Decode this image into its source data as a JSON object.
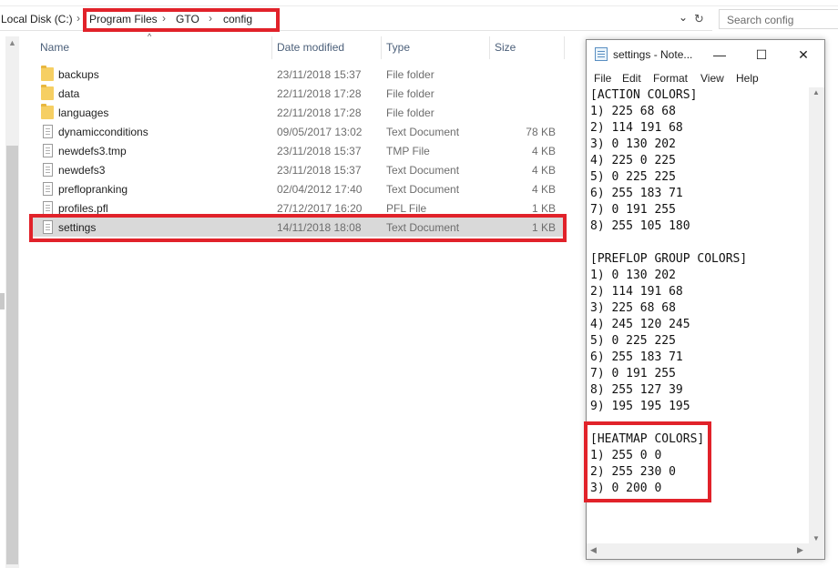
{
  "explorer": {
    "breadcrumb": [
      "Local Disk (C:)",
      "Program Files",
      "GTO",
      "config"
    ],
    "search_placeholder": "Search config",
    "columns": {
      "name": "Name",
      "date": "Date modified",
      "type": "Type",
      "size": "Size"
    },
    "files": [
      {
        "name": "backups",
        "date": "23/11/2018 15:37",
        "type": "File folder",
        "size": "",
        "icon": "folder-icon"
      },
      {
        "name": "data",
        "date": "22/11/2018 17:28",
        "type": "File folder",
        "size": "",
        "icon": "folder-icon"
      },
      {
        "name": "languages",
        "date": "22/11/2018 17:28",
        "type": "File folder",
        "size": "",
        "icon": "folder-icon"
      },
      {
        "name": "dynamicconditions",
        "date": "09/05/2017 13:02",
        "type": "Text Document",
        "size": "78 KB",
        "icon": "document-icon"
      },
      {
        "name": "newdefs3.tmp",
        "date": "23/11/2018 15:37",
        "type": "TMP File",
        "size": "4 KB",
        "icon": "document-icon"
      },
      {
        "name": "newdefs3",
        "date": "23/11/2018 15:37",
        "type": "Text Document",
        "size": "4 KB",
        "icon": "document-icon"
      },
      {
        "name": "preflopranking",
        "date": "02/04/2012 17:40",
        "type": "Text Document",
        "size": "4 KB",
        "icon": "document-icon"
      },
      {
        "name": "profiles.pfl",
        "date": "27/12/2017 16:20",
        "type": "PFL File",
        "size": "1 KB",
        "icon": "document-icon"
      },
      {
        "name": "settings",
        "date": "14/11/2018 18:08",
        "type": "Text Document",
        "size": "1 KB",
        "icon": "document-icon",
        "selected": true
      }
    ]
  },
  "notepad": {
    "title": "settings - Note...",
    "window_buttons": {
      "minimize": "—",
      "maximize": "☐",
      "close": "✕"
    },
    "menu": [
      "File",
      "Edit",
      "Format",
      "View",
      "Help"
    ],
    "lines": [
      "[ACTION COLORS]",
      "1) 225 68 68",
      "2) 114 191 68",
      "3) 0 130 202",
      "4) 225 0 225",
      "5) 0 225 225",
      "6) 255 183 71",
      "7) 0 191 255",
      "8) 255 105 180",
      "",
      "[PREFLOP GROUP COLORS]",
      "1) 0 130 202",
      "2) 114 191 68",
      "3) 225 68 68",
      "4) 245 120 245",
      "5) 0 225 225",
      "6) 255 183 71",
      "7) 0 191 255",
      "8) 255 127 39",
      "9) 195 195 195",
      "",
      "[HEATMAP COLORS]",
      "1) 255 0 0",
      "2) 255 230 0",
      "3) 0 200 0"
    ]
  },
  "colors": {
    "highlight": "#e1222a",
    "selection": "#d9d9d9",
    "folder": "#f6cf63"
  }
}
